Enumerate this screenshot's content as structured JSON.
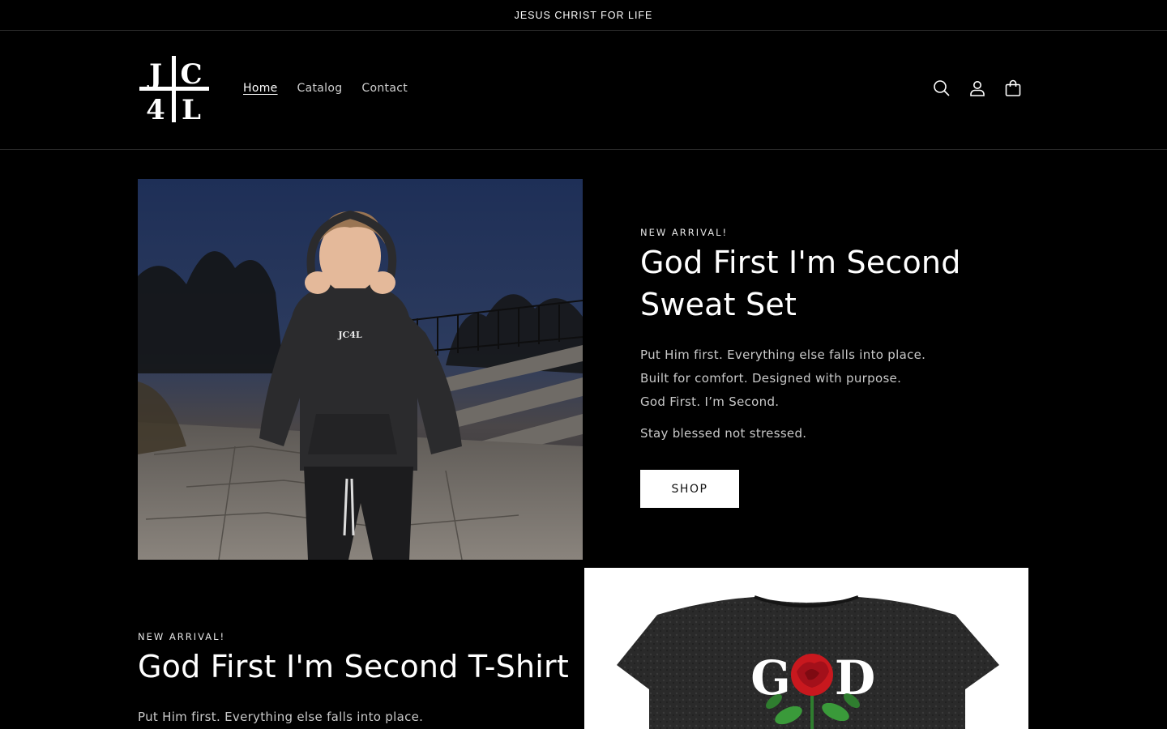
{
  "announcement": {
    "text": "JESUS CHRIST FOR LIFE"
  },
  "header": {
    "logo_letters": "JC4L",
    "nav": [
      {
        "label": "Home",
        "active": true
      },
      {
        "label": "Catalog",
        "active": false
      },
      {
        "label": "Contact",
        "active": false
      }
    ],
    "icons": [
      "search-icon",
      "account-icon",
      "cart-icon"
    ]
  },
  "featured": [
    {
      "eyebrow": "NEW ARRIVAL!",
      "title": "God First I'm Second Sweat Set",
      "body_lines": [
        "Put Him first. Everything else falls into place.",
        "Built for comfort. Designed with purpose.",
        "God First. I’m Second."
      ],
      "tagline": "Stay blessed not stressed.",
      "button_label": "SHOP",
      "image_text": "JC4L"
    },
    {
      "eyebrow": "NEW ARRIVAL!",
      "title": "God First I'm Second T-Shirt",
      "body_lines": [
        "Put Him first. Everything else falls into place."
      ],
      "image_text_left": "G",
      "image_text_right": "D"
    }
  ],
  "colors": {
    "background": "#000000",
    "text": "#ffffff",
    "muted": "#c9c9c9",
    "button_bg": "#ffffff",
    "rose": "#c8181e"
  }
}
